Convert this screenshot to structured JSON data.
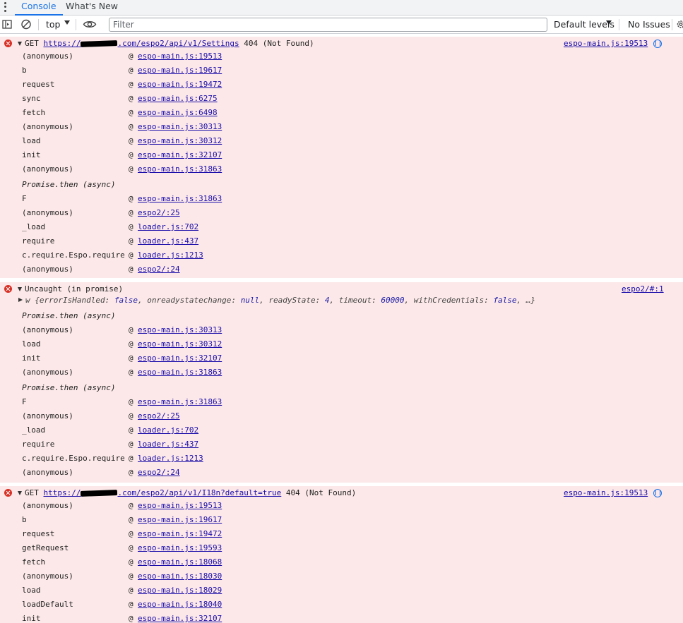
{
  "tabs": [
    {
      "label": "Console",
      "active": true
    },
    {
      "label": "What's New",
      "active": false
    }
  ],
  "toolbar": {
    "context": "top",
    "filter_placeholder": "Filter",
    "levels": "Default levels",
    "issues": "No Issues"
  },
  "messages": [
    {
      "method": "GET",
      "url_prefix": "https://",
      "url_suffix": ".com/espo2/api/v1/Settings",
      "status": "404 (Not Found)",
      "source": "espo-main.js:19513",
      "stack": [
        {
          "fn": "(anonymous)",
          "at": "@",
          "loc": "espo-main.js:19513"
        },
        {
          "fn": "b",
          "at": "@",
          "loc": "espo-main.js:19617"
        },
        {
          "fn": "request",
          "at": "@",
          "loc": "espo-main.js:19472"
        },
        {
          "fn": "sync",
          "at": "@",
          "loc": "espo-main.js:6275"
        },
        {
          "fn": "fetch",
          "at": "@",
          "loc": "espo-main.js:6498"
        },
        {
          "fn": "(anonymous)",
          "at": "@",
          "loc": "espo-main.js:30313"
        },
        {
          "fn": "load",
          "at": "@",
          "loc": "espo-main.js:30312"
        },
        {
          "fn": "init",
          "at": "@",
          "loc": "espo-main.js:32107"
        },
        {
          "fn": "(anonymous)",
          "at": "@",
          "loc": "espo-main.js:31863"
        },
        {
          "async": "Promise.then (async)"
        },
        {
          "fn": "F",
          "at": "@",
          "loc": "espo-main.js:31863"
        },
        {
          "fn": "(anonymous)",
          "at": "@",
          "loc": "espo2/:25"
        },
        {
          "fn": "_load",
          "at": "@",
          "loc": "loader.js:702"
        },
        {
          "fn": "require",
          "at": "@",
          "loc": "loader.js:437"
        },
        {
          "fn": "c.require.Espo.require",
          "at": "@",
          "loc": "loader.js:1213"
        },
        {
          "fn": "(anonymous)",
          "at": "@",
          "loc": "espo2/:24"
        }
      ]
    },
    {
      "title": "Uncaught (in promise)",
      "source": "espo2/#:1",
      "object": {
        "name": "w",
        "props": [
          {
            "k": "errorIsHandled",
            "v": "false"
          },
          {
            "k": "onreadystatechange",
            "v": "null"
          },
          {
            "k": "readyState",
            "v": "4"
          },
          {
            "k": "timeout",
            "v": "60000"
          },
          {
            "k": "withCredentials",
            "v": "false"
          }
        ],
        "more": "…}"
      },
      "stack": [
        {
          "async": "Promise.then (async)"
        },
        {
          "fn": "(anonymous)",
          "at": "@",
          "loc": "espo-main.js:30313"
        },
        {
          "fn": "load",
          "at": "@",
          "loc": "espo-main.js:30312"
        },
        {
          "fn": "init",
          "at": "@",
          "loc": "espo-main.js:32107"
        },
        {
          "fn": "(anonymous)",
          "at": "@",
          "loc": "espo-main.js:31863"
        },
        {
          "async": "Promise.then (async)"
        },
        {
          "fn": "F",
          "at": "@",
          "loc": "espo-main.js:31863"
        },
        {
          "fn": "(anonymous)",
          "at": "@",
          "loc": "espo2/:25"
        },
        {
          "fn": "_load",
          "at": "@",
          "loc": "loader.js:702"
        },
        {
          "fn": "require",
          "at": "@",
          "loc": "loader.js:437"
        },
        {
          "fn": "c.require.Espo.require",
          "at": "@",
          "loc": "loader.js:1213"
        },
        {
          "fn": "(anonymous)",
          "at": "@",
          "loc": "espo2/:24"
        }
      ]
    },
    {
      "method": "GET",
      "url_prefix": "https://",
      "url_suffix": ".com/espo2/api/v1/I18n?default=true",
      "status": "404 (Not Found)",
      "source": "espo-main.js:19513",
      "stack": [
        {
          "fn": "(anonymous)",
          "at": "@",
          "loc": "espo-main.js:19513"
        },
        {
          "fn": "b",
          "at": "@",
          "loc": "espo-main.js:19617"
        },
        {
          "fn": "request",
          "at": "@",
          "loc": "espo-main.js:19472"
        },
        {
          "fn": "getRequest",
          "at": "@",
          "loc": "espo-main.js:19593"
        },
        {
          "fn": "fetch",
          "at": "@",
          "loc": "espo-main.js:18068"
        },
        {
          "fn": "(anonymous)",
          "at": "@",
          "loc": "espo-main.js:18030"
        },
        {
          "fn": "load",
          "at": "@",
          "loc": "espo-main.js:18029"
        },
        {
          "fn": "loadDefault",
          "at": "@",
          "loc": "espo-main.js:18040"
        },
        {
          "fn": "init",
          "at": "@",
          "loc": "espo-main.js:32107"
        }
      ]
    }
  ]
}
